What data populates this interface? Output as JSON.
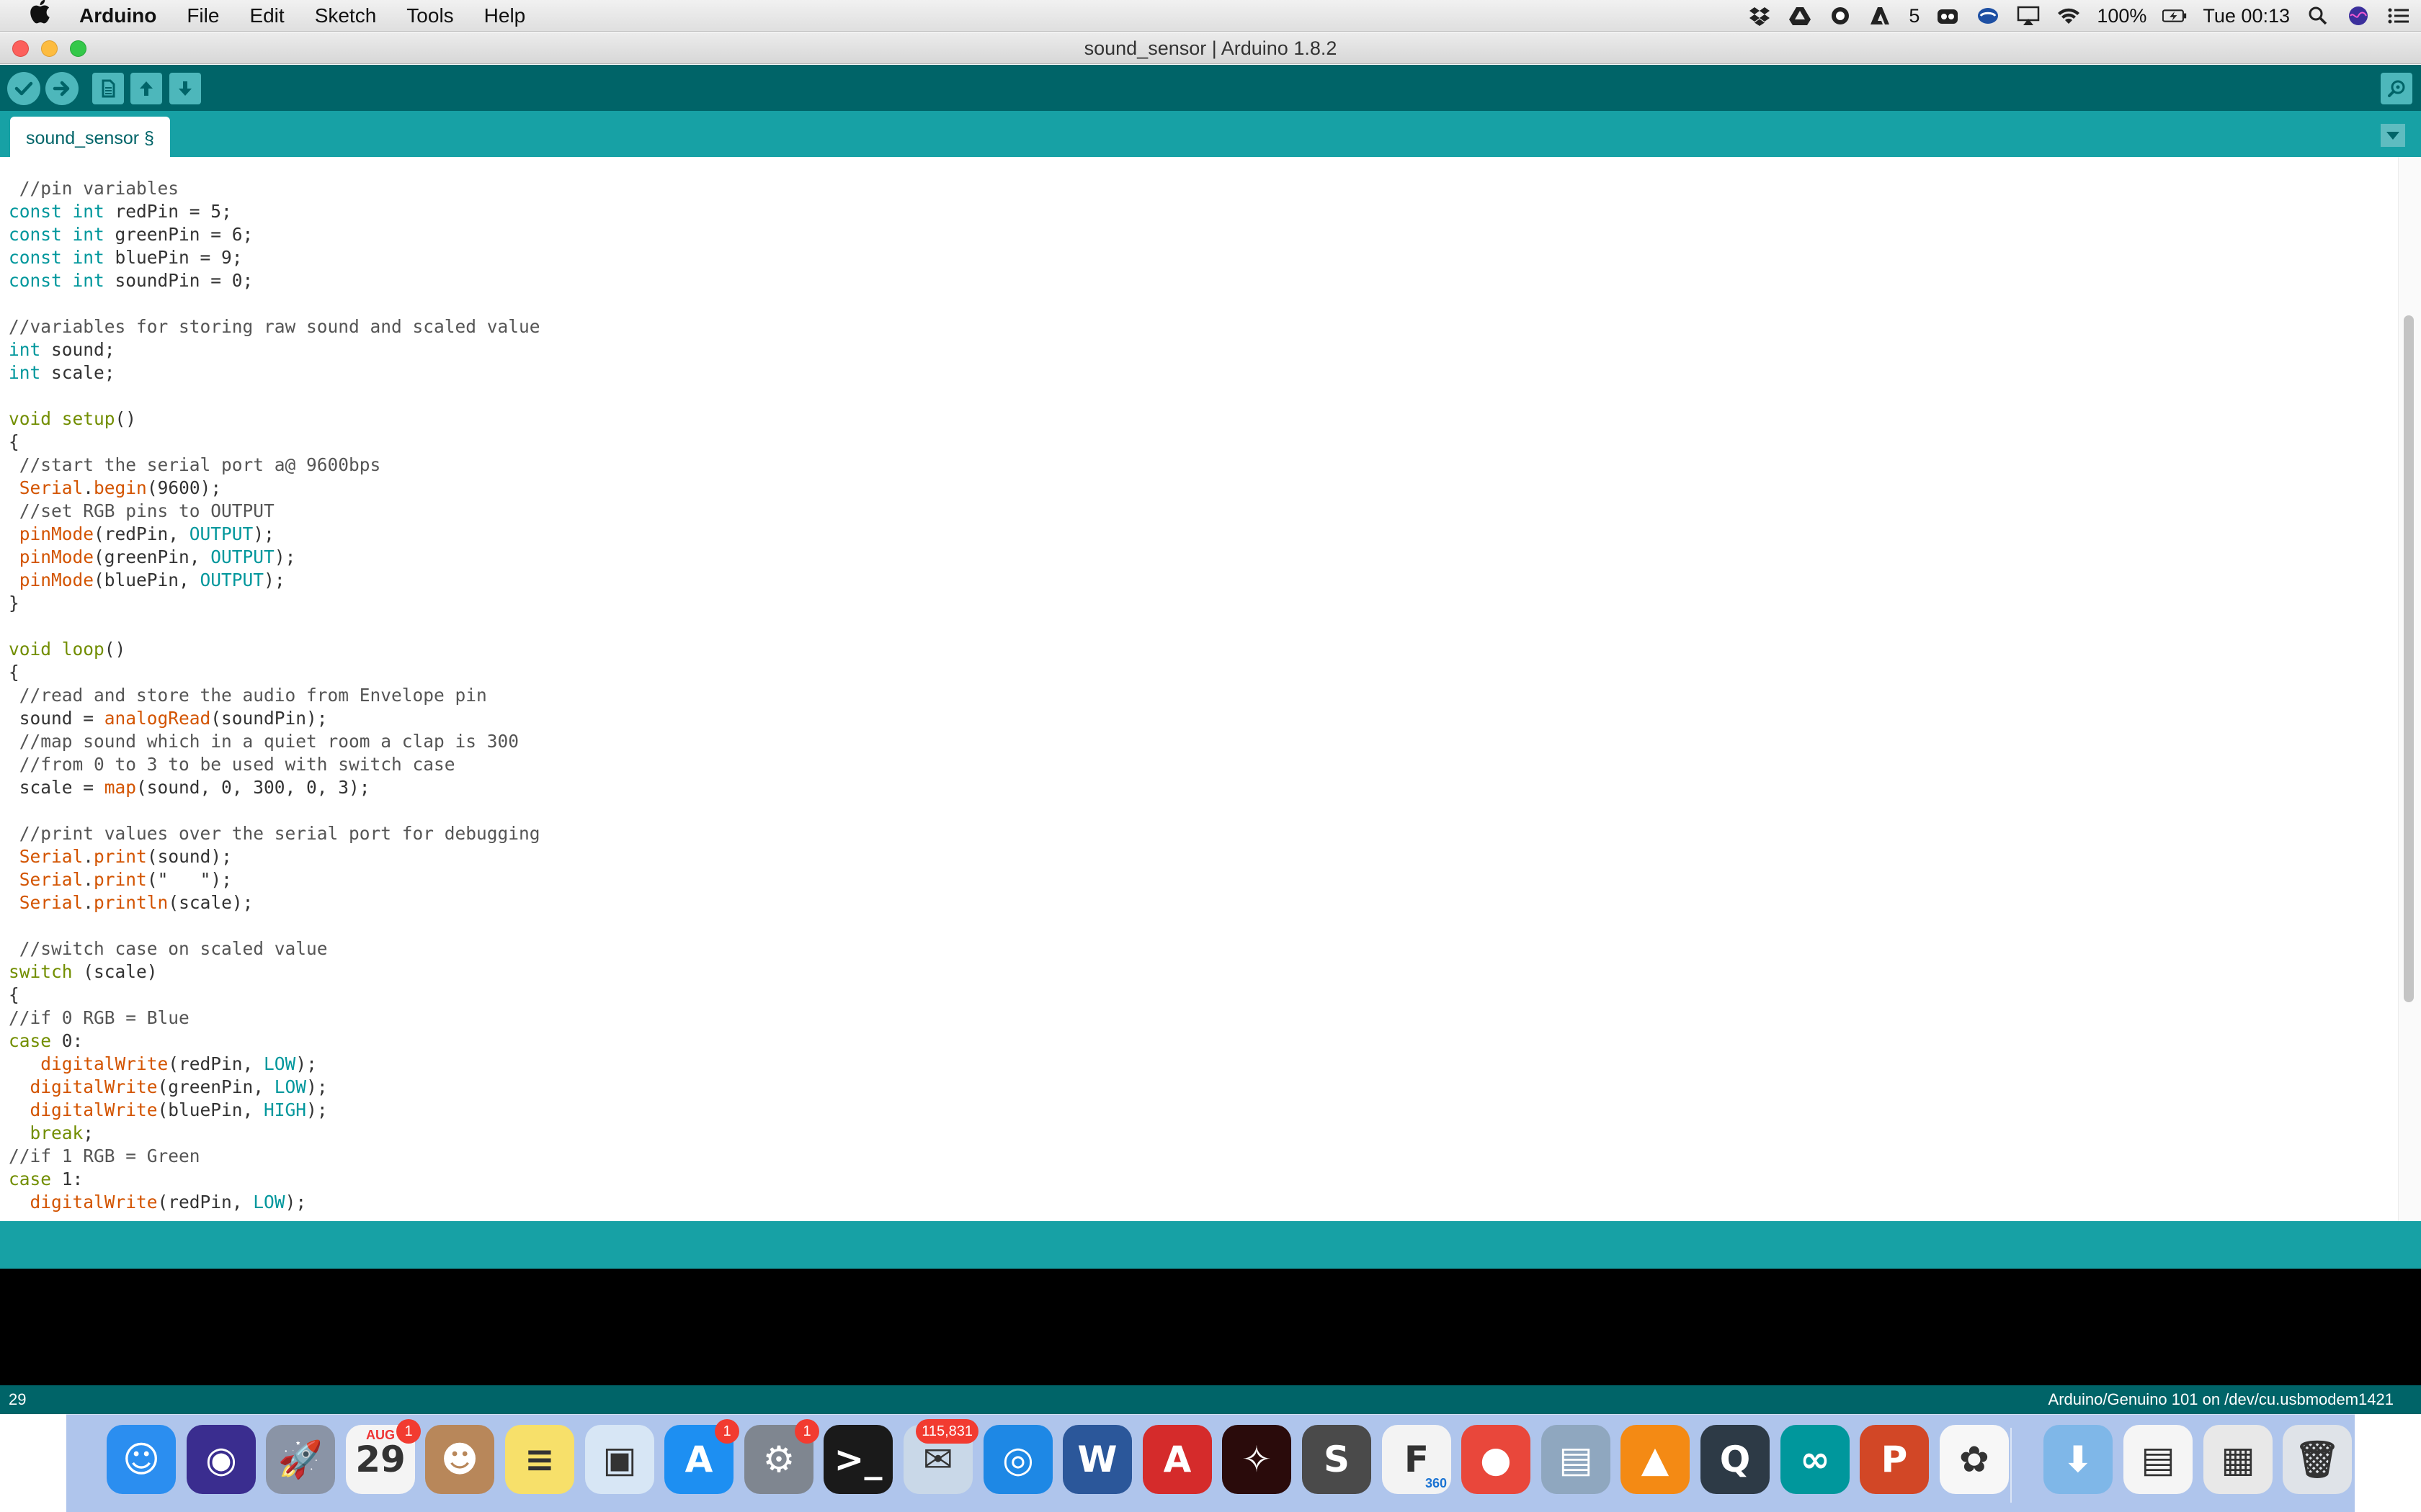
{
  "menubar": {
    "apple_icon": "apple-logo-icon",
    "app_name": "Arduino",
    "menus": [
      "File",
      "Edit",
      "Sketch",
      "Tools",
      "Help"
    ],
    "status_icons": [
      "dropbox-icon",
      "google-drive-icon",
      "radio-record-icon",
      "adobe-icon",
      "creative-cloud-icon",
      "sync-icon",
      "airplay-icon",
      "wifi-icon"
    ],
    "adobe_count": "5",
    "battery": "100%",
    "clock": "Tue 00:13",
    "right_icons": [
      "spotlight-icon",
      "siri-icon",
      "notification-center-icon"
    ]
  },
  "window": {
    "title": "sound_sensor | Arduino 1.8.2"
  },
  "toolbar": {
    "buttons": [
      "verify-icon",
      "upload-icon",
      "new-icon",
      "open-icon",
      "save-icon"
    ],
    "serial_monitor_icon": "serial-monitor-icon"
  },
  "tabs": {
    "active": "sound_sensor §",
    "menu_icon": "tab-menu-triangle-icon"
  },
  "code_lines": [
    [
      {
        "t": " //pin variables",
        "c": "cm"
      }
    ],
    [
      {
        "t": "const",
        "c": "kw"
      },
      {
        "t": " "
      },
      {
        "t": "int",
        "c": "kw"
      },
      {
        "t": " redPin = 5;"
      }
    ],
    [
      {
        "t": "const",
        "c": "kw"
      },
      {
        "t": " "
      },
      {
        "t": "int",
        "c": "kw"
      },
      {
        "t": " greenPin = 6;"
      }
    ],
    [
      {
        "t": "const",
        "c": "kw"
      },
      {
        "t": " "
      },
      {
        "t": "int",
        "c": "kw"
      },
      {
        "t": " bluePin = 9;"
      }
    ],
    [
      {
        "t": "const",
        "c": "kw"
      },
      {
        "t": " "
      },
      {
        "t": "int",
        "c": "kw"
      },
      {
        "t": " soundPin = 0;"
      }
    ],
    [],
    [
      {
        "t": "//variables for storing raw sound and scaled value",
        "c": "cm"
      }
    ],
    [
      {
        "t": "int",
        "c": "kw"
      },
      {
        "t": " sound;"
      }
    ],
    [
      {
        "t": "int",
        "c": "kw"
      },
      {
        "t": " scale;"
      }
    ],
    [],
    [
      {
        "t": "void",
        "c": "ctl"
      },
      {
        "t": " "
      },
      {
        "t": "setup",
        "c": "ctl"
      },
      {
        "t": "()"
      }
    ],
    [
      {
        "t": "{"
      }
    ],
    [
      {
        "t": " //start the serial port a@ 9600bps",
        "c": "cm"
      }
    ],
    [
      {
        "t": " "
      },
      {
        "t": "Serial",
        "c": "fn"
      },
      {
        "t": "."
      },
      {
        "t": "begin",
        "c": "fn"
      },
      {
        "t": "(9600);"
      }
    ],
    [
      {
        "t": " //set RGB pins to OUTPUT",
        "c": "cm"
      }
    ],
    [
      {
        "t": " "
      },
      {
        "t": "pinMode",
        "c": "fn"
      },
      {
        "t": "(redPin, "
      },
      {
        "t": "OUTPUT",
        "c": "const"
      },
      {
        "t": ");"
      }
    ],
    [
      {
        "t": " "
      },
      {
        "t": "pinMode",
        "c": "fn"
      },
      {
        "t": "(greenPin, "
      },
      {
        "t": "OUTPUT",
        "c": "const"
      },
      {
        "t": ");"
      }
    ],
    [
      {
        "t": " "
      },
      {
        "t": "pinMode",
        "c": "fn"
      },
      {
        "t": "(bluePin, "
      },
      {
        "t": "OUTPUT",
        "c": "const"
      },
      {
        "t": ");"
      }
    ],
    [
      {
        "t": "}"
      }
    ],
    [],
    [
      {
        "t": "void",
        "c": "ctl"
      },
      {
        "t": " "
      },
      {
        "t": "loop",
        "c": "ctl"
      },
      {
        "t": "()"
      }
    ],
    [
      {
        "t": "{"
      }
    ],
    [
      {
        "t": " //read and store the audio from Envelope pin",
        "c": "cm"
      }
    ],
    [
      {
        "t": " sound = "
      },
      {
        "t": "analogRead",
        "c": "fn"
      },
      {
        "t": "(soundPin);"
      }
    ],
    [
      {
        "t": " //map sound which in a quiet room a clap is 300",
        "c": "cm"
      }
    ],
    [
      {
        "t": " //from 0 to 3 to be used with switch case",
        "c": "cm"
      }
    ],
    [
      {
        "t": " scale = "
      },
      {
        "t": "map",
        "c": "fn"
      },
      {
        "t": "(sound, 0, 300, 0, 3);"
      }
    ],
    [],
    [
      {
        "t": " //print values over the serial port for debugging",
        "c": "cm"
      }
    ],
    [
      {
        "t": " "
      },
      {
        "t": "Serial",
        "c": "fn"
      },
      {
        "t": "."
      },
      {
        "t": "print",
        "c": "fn"
      },
      {
        "t": "(sound);"
      }
    ],
    [
      {
        "t": " "
      },
      {
        "t": "Serial",
        "c": "fn"
      },
      {
        "t": "."
      },
      {
        "t": "print",
        "c": "fn"
      },
      {
        "t": "(\"   \");"
      }
    ],
    [
      {
        "t": " "
      },
      {
        "t": "Serial",
        "c": "fn"
      },
      {
        "t": "."
      },
      {
        "t": "println",
        "c": "fn"
      },
      {
        "t": "(scale);"
      }
    ],
    [],
    [
      {
        "t": " //switch case on scaled value",
        "c": "cm"
      }
    ],
    [
      {
        "t": "switch",
        "c": "ctl"
      },
      {
        "t": " (scale)"
      }
    ],
    [
      {
        "t": "{"
      }
    ],
    [
      {
        "t": "//if 0 RGB = Blue",
        "c": "cm"
      }
    ],
    [
      {
        "t": "case",
        "c": "ctl"
      },
      {
        "t": " 0:"
      }
    ],
    [
      {
        "t": "   "
      },
      {
        "t": "digitalWrite",
        "c": "fn"
      },
      {
        "t": "(redPin, "
      },
      {
        "t": "LOW",
        "c": "const"
      },
      {
        "t": ");"
      }
    ],
    [
      {
        "t": "  "
      },
      {
        "t": "digitalWrite",
        "c": "fn"
      },
      {
        "t": "(greenPin, "
      },
      {
        "t": "LOW",
        "c": "const"
      },
      {
        "t": ");"
      }
    ],
    [
      {
        "t": "  "
      },
      {
        "t": "digitalWrite",
        "c": "fn"
      },
      {
        "t": "(bluePin, "
      },
      {
        "t": "HIGH",
        "c": "const"
      },
      {
        "t": ");"
      }
    ],
    [
      {
        "t": "  "
      },
      {
        "t": "break",
        "c": "ctl"
      },
      {
        "t": ";"
      }
    ],
    [
      {
        "t": "//if 1 RGB = Green",
        "c": "cm"
      }
    ],
    [
      {
        "t": "case",
        "c": "ctl"
      },
      {
        "t": " 1:"
      }
    ],
    [
      {
        "t": "  "
      },
      {
        "t": "digitalWrite",
        "c": "fn"
      },
      {
        "t": "(redPin, "
      },
      {
        "t": "LOW",
        "c": "const"
      },
      {
        "t": ");"
      }
    ]
  ],
  "status": {
    "line_number": "29",
    "board": "Arduino/Genuino 101 on /dev/cu.usbmodem1421"
  },
  "dock": {
    "apps": [
      {
        "name": "finder-icon",
        "glyph": "☺",
        "color": "#2b8ef0"
      },
      {
        "name": "siri-icon",
        "glyph": "◉",
        "color": "#3a2d8f"
      },
      {
        "name": "launchpad-icon",
        "glyph": "🚀",
        "color": "#8a94a6"
      },
      {
        "name": "calendar-icon",
        "glyph": "29",
        "color": "#f4f4f4",
        "badge": "1",
        "label": "AUG"
      },
      {
        "name": "contacts-icon",
        "glyph": "☻",
        "color": "#b8875a"
      },
      {
        "name": "notes-icon",
        "glyph": "≡",
        "color": "#f7e06a"
      },
      {
        "name": "preview-icon",
        "glyph": "▣",
        "color": "#d7e6f5"
      },
      {
        "name": "app-store-icon",
        "glyph": "A",
        "color": "#1d8ff2",
        "badge": "1"
      },
      {
        "name": "system-preferences-icon",
        "glyph": "⚙",
        "color": "#7f8690",
        "badge": "1"
      },
      {
        "name": "terminal-icon",
        "glyph": ">_",
        "color": "#1a1a1a"
      },
      {
        "name": "mail-icon",
        "glyph": "✉",
        "color": "#c9d8e8",
        "badge": "115,831"
      },
      {
        "name": "safari-icon",
        "glyph": "◎",
        "color": "#1e88e5"
      },
      {
        "name": "word-icon",
        "glyph": "W",
        "color": "#2b579a"
      },
      {
        "name": "autocad-icon",
        "glyph": "A",
        "color": "#d52b2b"
      },
      {
        "name": "acrobat-icon",
        "glyph": "✧",
        "color": "#2a0b0b"
      },
      {
        "name": "sublime-text-icon",
        "glyph": "S",
        "color": "#4a4a4a"
      },
      {
        "name": "fusion-360-icon",
        "glyph": "F",
        "color": "#f3f3f3",
        "label": "360"
      },
      {
        "name": "chrome-icon",
        "glyph": "●",
        "color": "#e9473b"
      },
      {
        "name": "image-capture-icon",
        "glyph": "▤",
        "color": "#8fa7bf"
      },
      {
        "name": "vlc-icon",
        "glyph": "▲",
        "color": "#f48a14"
      },
      {
        "name": "quicktime-icon",
        "glyph": "Q",
        "color": "#2d3a46"
      },
      {
        "name": "arduino-icon",
        "glyph": "∞",
        "color": "#00979c"
      },
      {
        "name": "powerpoint-icon",
        "glyph": "P",
        "color": "#d24726"
      },
      {
        "name": "photos-icon",
        "glyph": "✿",
        "color": "#f7f7f7"
      },
      {
        "name": "downloads-folder-icon",
        "glyph": "⬇",
        "color": "#7fb7e8"
      },
      {
        "name": "document-icon",
        "glyph": "▤",
        "color": "#f5f5f5"
      },
      {
        "name": "screenshot-icon",
        "glyph": "▦",
        "color": "#e8e8e8"
      },
      {
        "name": "trash-icon",
        "glyph": "🗑",
        "color": "#dfe3e8"
      }
    ]
  },
  "colors": {
    "toolbar": "#006468",
    "tabbar": "#17a1a5",
    "keyword": "#00979c",
    "function": "#d35400",
    "control": "#728e00",
    "comment": "#555555"
  }
}
